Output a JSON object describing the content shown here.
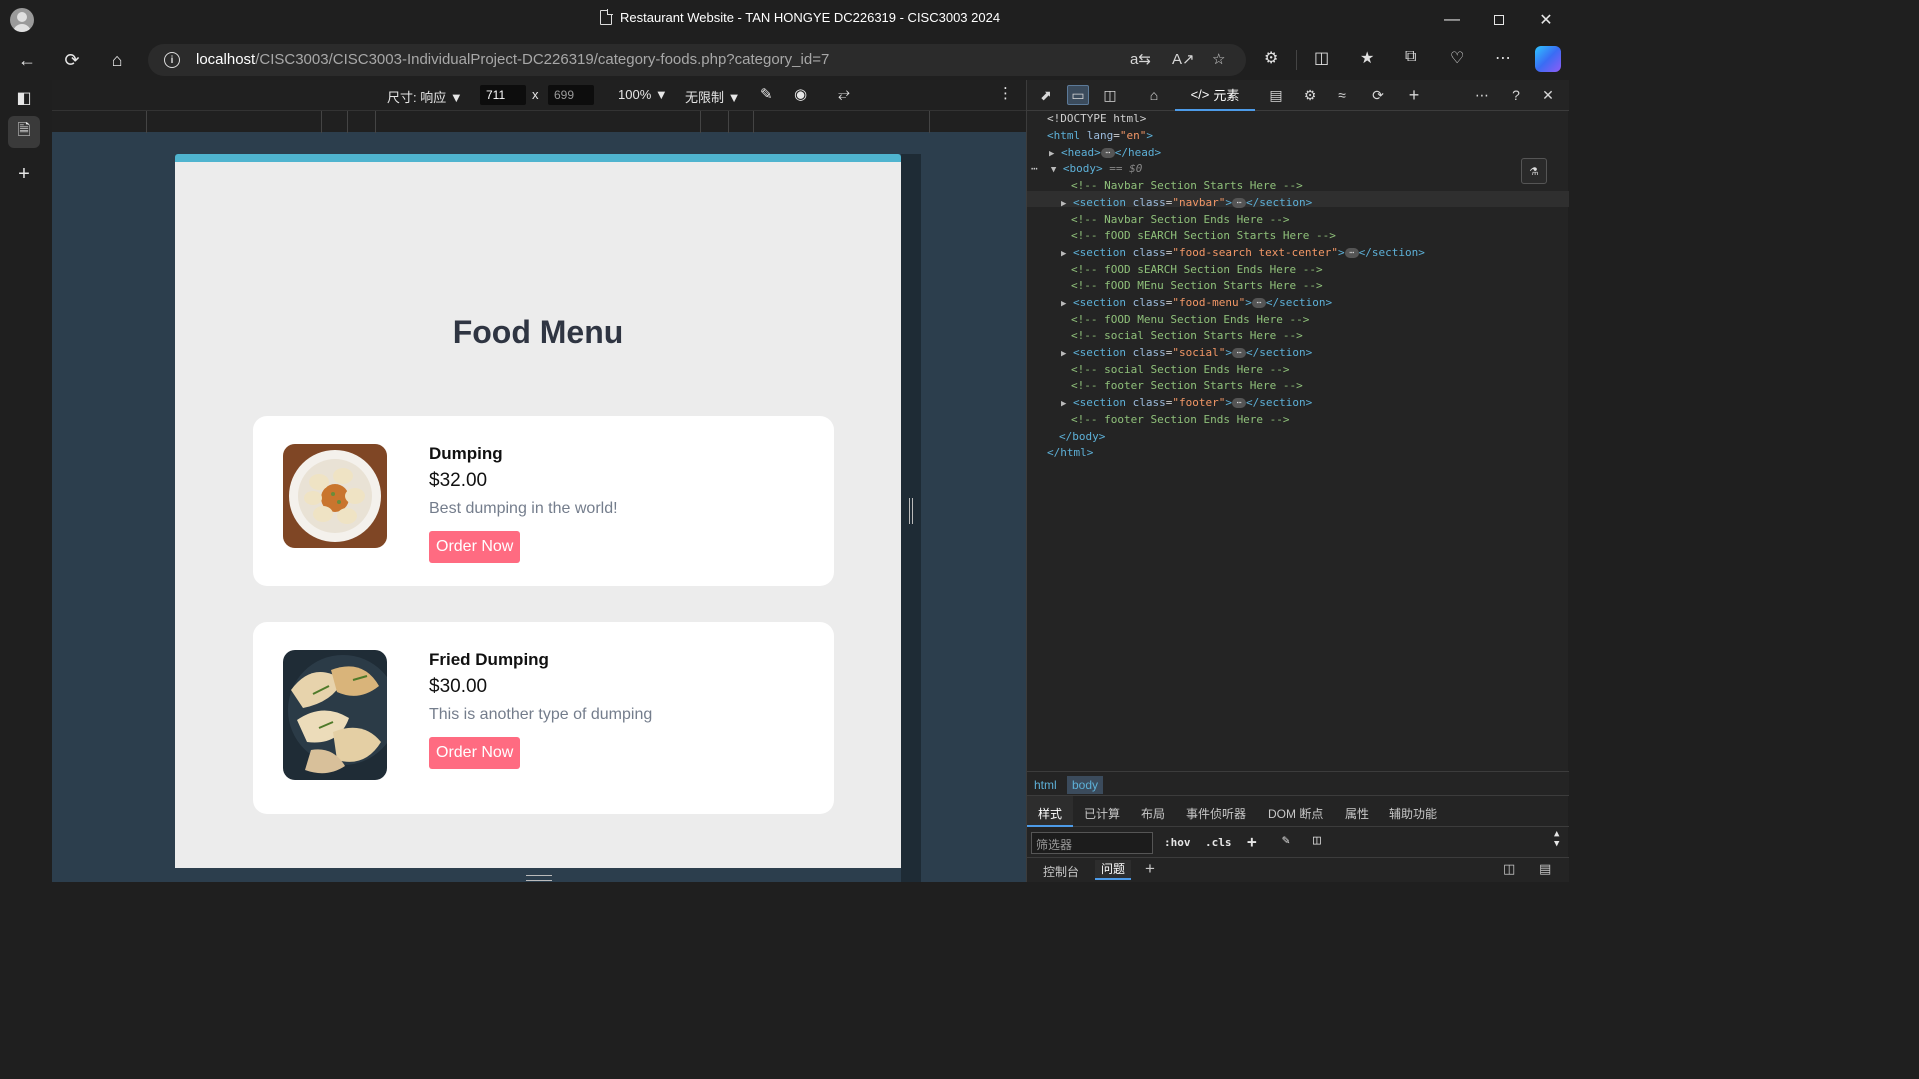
{
  "browser": {
    "window_title": "Restaurant Website - TAN HONGYE DC226319 - CISC3003 2024",
    "url_host": "localhost",
    "url_path": "/CISC3003/CISC3003-IndividualProject-DC226319/category-foods.php?category_id=7"
  },
  "emulation": {
    "dimensions_label": "尺寸: 响应",
    "width_value": "711",
    "times_sign": "x",
    "height_value": "699",
    "zoom_label": "100%",
    "throttle_label": "无限制"
  },
  "page": {
    "heading": "Food Menu",
    "foods": [
      {
        "name": "Dumping",
        "price": "$32.00",
        "description": "Best dumping in the world!",
        "button": "Order Now"
      },
      {
        "name": "Fried Dumping",
        "price": "$30.00",
        "description": "This is another type of dumping",
        "button": "Order Now"
      }
    ]
  },
  "devtools": {
    "elements_tab_label": "元素",
    "breadcrumbs": [
      "html",
      "body"
    ],
    "style_tabs": [
      "样式",
      "已计算",
      "布局",
      "事件侦听器",
      "DOM 断点",
      "属性",
      "辅助功能"
    ],
    "filter_placeholder": "筛选器",
    "hov_label": ":hov",
    "cls_label": ".cls",
    "drawer_tabs": [
      "控制台",
      "问题"
    ],
    "body_marker": "== $0",
    "dom": {
      "doctype": "<!DOCTYPE html>",
      "html_open_tag": "<html",
      "html_lang_attr": "lang",
      "html_lang_value": "\"en\"",
      "head_open": "<head>",
      "head_close": "</head>",
      "body_open": "<body>",
      "body_close": "</body>",
      "html_close": "</html>",
      "section_open": "<section",
      "section_close": "</section>",
      "class_attr": "class",
      "comments": [
        "<!-- Navbar Section Starts Here -->",
        "<!-- Navbar Section Ends Here -->",
        "<!-- fOOD sEARCH Section Starts Here -->",
        "<!-- fOOD sEARCH Section Ends Here -->",
        "<!-- fOOD MEnu Section Starts Here -->",
        "<!-- fOOD Menu Section Ends Here -->",
        "<!-- social Section Starts Here -->",
        "<!-- social Section Ends Here -->",
        "<!-- footer Section Starts Here -->",
        "<!-- footer Section Ends Here -->"
      ],
      "section_classes": [
        "\"navbar\"",
        "\"food-search text-center\"",
        "\"food-menu\"",
        "\"social\"",
        "\"footer\""
      ]
    }
  }
}
